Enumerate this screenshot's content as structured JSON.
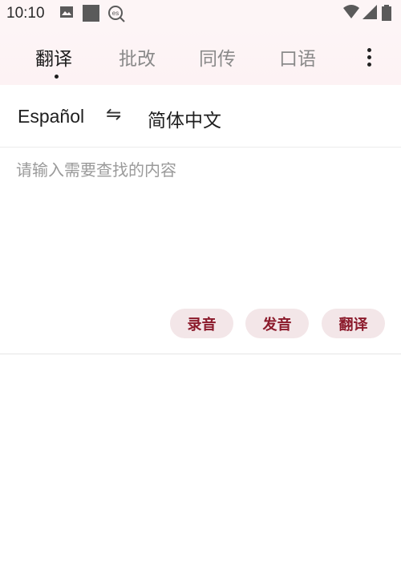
{
  "status_bar": {
    "time": "10:10",
    "icons": [
      "image-icon",
      "square-icon",
      "es-icon",
      "wifi-icon",
      "signal-icon",
      "battery-icon"
    ]
  },
  "tabs": [
    {
      "label": "翻译",
      "active": true
    },
    {
      "label": "批改",
      "active": false
    },
    {
      "label": "同传",
      "active": false
    },
    {
      "label": "口语",
      "active": false
    }
  ],
  "more_icon": "more-vertical-icon",
  "languages": {
    "source": "Español",
    "swap_symbol": "⇋",
    "target": "简体中文"
  },
  "input": {
    "value": "",
    "placeholder": "请输入需要查找的内容"
  },
  "actions": {
    "record_label": "录音",
    "speak_label": "发音",
    "translate_label": "翻译"
  },
  "colors": {
    "accent": "#8b1a2b",
    "button_bg": "#f3e6e8",
    "header_bg": "#fdf5f6"
  }
}
